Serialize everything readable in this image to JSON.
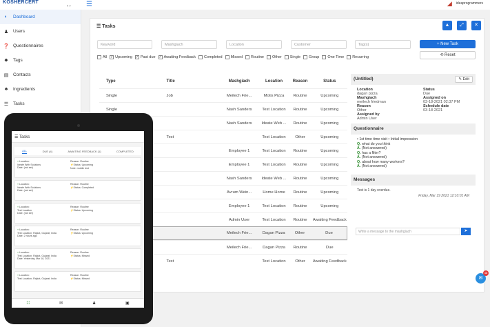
{
  "header": {
    "brand": "KOSHERCERT",
    "collapse_arrows": "‹ ›",
    "user_name": "ideaprogrammers"
  },
  "sidebar": {
    "items": [
      {
        "label": "Dashboard",
        "icon": "dashboard-icon",
        "glyph": "◐"
      },
      {
        "label": "Users",
        "icon": "users-icon",
        "glyph": "♟"
      },
      {
        "label": "Questionnaires",
        "icon": "question-icon",
        "glyph": "❓"
      },
      {
        "label": "Tags",
        "icon": "tag-icon",
        "glyph": "⬥"
      },
      {
        "label": "Contacts",
        "icon": "contact-card-icon",
        "glyph": "▤"
      },
      {
        "label": "Ingredients",
        "icon": "ingredients-icon",
        "glyph": "♣"
      },
      {
        "label": "Tasks",
        "icon": "tasks-icon",
        "glyph": "☰"
      }
    ]
  },
  "panel": {
    "title": "Tasks",
    "buttons": [
      "▲",
      "⤢",
      "✕"
    ]
  },
  "filters": {
    "keyword": "Keyword",
    "mashgiach": "Mashgiach",
    "location": "Location",
    "customer": "Customer",
    "tags": "Tag(s)",
    "new_task": "+ New Task",
    "reset": "⟲ Reset",
    "checks": [
      {
        "label": "All",
        "checked": false
      },
      {
        "label": "Upcoming",
        "checked": true
      },
      {
        "label": "Past due",
        "checked": true
      },
      {
        "label": "Awaiting Feedback",
        "checked": true
      },
      {
        "label": "Completed",
        "checked": false
      },
      {
        "label": "Missed",
        "checked": false
      },
      {
        "label": "Routine",
        "checked": false
      },
      {
        "label": "Other",
        "checked": false
      },
      {
        "label": "Single",
        "checked": false
      },
      {
        "label": "Group",
        "checked": false
      },
      {
        "label": "One Time",
        "checked": false
      },
      {
        "label": "Recurring",
        "checked": false
      }
    ]
  },
  "table": {
    "headers": {
      "type": "Type",
      "title": "Title",
      "mashgiach": "Mashgiach",
      "location": "Location",
      "reason": "Reason",
      "status": "Status"
    },
    "rows": [
      {
        "type": "Single",
        "title": "Job",
        "mashgiach": "Meilech Frie...",
        "location": "Motis Pizza",
        "reason": "Routine",
        "status": "Upcoming"
      },
      {
        "type": "Single",
        "title": "",
        "mashgiach": "Nash Sanders",
        "location": "Test Location",
        "reason": "Routine",
        "status": "Upcoming"
      },
      {
        "type": "",
        "title": "",
        "mashgiach": "Nash Sanders",
        "location": "Ideate Web ...",
        "reason": "Routine",
        "status": "Upcoming"
      },
      {
        "type": "",
        "title": "Test",
        "mashgiach": "",
        "location": "Test Location",
        "reason": "Other",
        "status": "Upcoming"
      },
      {
        "type": "",
        "title": "",
        "mashgiach": "Employee 1",
        "location": "Test Location",
        "reason": "Routine",
        "status": "Upcoming"
      },
      {
        "type": "",
        "title": "",
        "mashgiach": "Employee 1",
        "location": "Test Location",
        "reason": "Routine",
        "status": "Upcoming"
      },
      {
        "type": "",
        "title": "",
        "mashgiach": "Nash Sanders",
        "location": "Ideate Web ...",
        "reason": "Routine",
        "status": "Upcoming"
      },
      {
        "type": "",
        "title": "",
        "mashgiach": "Avrum Wein...",
        "location": "Home Home",
        "reason": "Routine",
        "status": "Upcoming"
      },
      {
        "type": "",
        "title": "",
        "mashgiach": "Employee 1",
        "location": "Test Location",
        "reason": "Routine",
        "status": "Upcoming"
      },
      {
        "type": "",
        "title": "",
        "mashgiach": "Admin User",
        "location": "Test Location",
        "reason": "Routine",
        "status": "Awaiting Feedback"
      },
      {
        "type": "",
        "title": "",
        "mashgiach": "Meilech Frie...",
        "location": "Dagan Pizza",
        "reason": "Other",
        "status": "Due"
      },
      {
        "type": "",
        "title": "",
        "mashgiach": "Meilech Frie...",
        "location": "Dagan Pizza",
        "reason": "Routine",
        "status": "Due"
      },
      {
        "type": "",
        "title": "Test",
        "mashgiach": "",
        "location": "Test Location",
        "reason": "Other",
        "status": "Awaiting Feedback"
      }
    ]
  },
  "detail": {
    "heading": "(Untitled)",
    "edit": "✎ Edit",
    "left": [
      {
        "label": "Location",
        "value": "dagan pizza"
      },
      {
        "label": "Mashgiach",
        "value": "meilech friedman"
      },
      {
        "label": "Reason",
        "value": "Other"
      },
      {
        "label": "Assigned by",
        "value": "Admin User"
      }
    ],
    "right": [
      {
        "label": "Status",
        "value": "Due"
      },
      {
        "label": "Assigned on",
        "value": "03-18-2021 02:37 PM"
      },
      {
        "label": "Schedule date",
        "value": "03-18-2021"
      }
    ],
    "questionnaire_heading": "Questionnaire",
    "questionnaire_title": "• 1st time time visit • Initial impression",
    "qa": [
      {
        "q": "what do you think",
        "a": "(Not answered)"
      },
      {
        "q": "has a filter?",
        "a": "(Not answered)"
      },
      {
        "q": "about how many workers?",
        "a": "(Not answered)"
      }
    ],
    "q_prefix": "Q.",
    "a_prefix": "A.",
    "messages_heading": "Messages",
    "message_text": "Test is 1 day overdue.",
    "message_date": "Friday, Mar 19 2021 12:10:01 AM",
    "message_placeholder": "Write a message to the mashgiach",
    "send": "➤"
  },
  "chat": {
    "badge": "48",
    "glyph": "💬"
  },
  "tablet": {
    "title": "Tasks",
    "tabs": [
      "ALL",
      "DUE (4)",
      "AWAITING FEEDBACK (1)",
      "COMPLETED"
    ],
    "cards": [
      {
        "loc_label": "Location:",
        "loc": "Ideate Web Solutions",
        "date": "Date: (not set)",
        "reason": "Routine",
        "status": "Upcoming",
        "extra": "mobile test"
      },
      {
        "loc_label": "Location:",
        "loc": "Ideate Web Solutions",
        "date": "Date: (not set)",
        "reason": "Routine",
        "status": "Completed",
        "extra": ""
      },
      {
        "loc_label": "Location:",
        "loc": "Test Location",
        "date": "Date: (not set)",
        "reason": "Routine",
        "status": "Upcoming",
        "extra": ""
      },
      {
        "loc_label": "Location:",
        "loc": "Test Location, Rajkot, Gujarat, India",
        "date": "Date: 2 hours ago",
        "reason": "Routine",
        "status": "Upcoming",
        "extra": ""
      },
      {
        "loc_label": "Location:",
        "loc": "Test Location, Rajkot, Gujarat, India",
        "date": "Date: Yesterday, Mar 18, 2021",
        "reason": "Routine",
        "status": "Missed",
        "extra": ""
      },
      {
        "loc_label": "Location:",
        "loc": "Test Location, Rajkot, Gujarat, India",
        "date": "",
        "reason": "Routine",
        "status": "Missed",
        "extra": ""
      }
    ],
    "reason_label": "Reason:",
    "status_label": "Status:",
    "note_label": "Note:",
    "nav": [
      "⁞⁞⁞",
      "✉",
      "♟",
      "▣"
    ]
  },
  "colors": {
    "accent": "#1e6fd9",
    "success": "#2c8a2c",
    "danger": "#e23a3a"
  }
}
